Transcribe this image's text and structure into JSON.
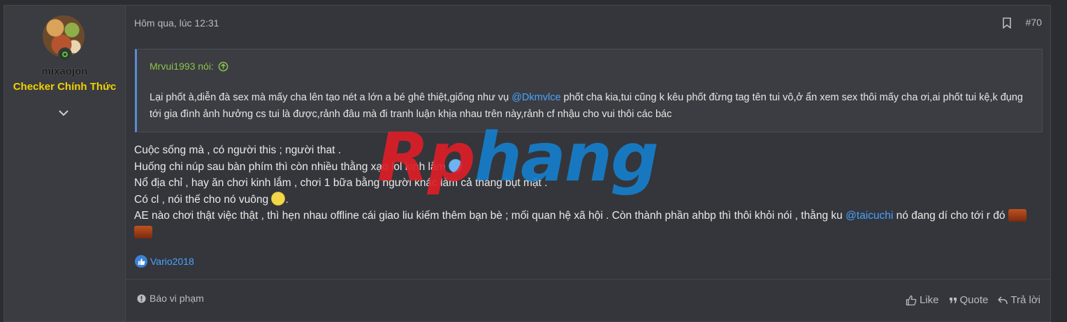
{
  "post": {
    "date": "Hôm qua, lúc 12:31",
    "number": "#70",
    "author": {
      "username": "mixaojon",
      "title": "Checker Chính Thức"
    },
    "quote": {
      "attribution": "Mrvui1993 nói:",
      "text_1": "Lại phốt à,diễn đà sex mà mấy cha lên tạo nét a lớn a bé ghê thiệt,giống như vụ ",
      "mention": "@Dkmvlce",
      "text_2": " phốt cha kia,tui cũng k kêu phốt đừng tag tên tui vô,ở ẩn xem sex thôi mấy cha ơi,ai phốt tui kệ,k đụng tới gia đình ảnh hưởng cs tui là được,rảnh đâu mà đi tranh luận khịa nhau trên này,rảnh cf nhậu cho vui thôi các bác"
    },
    "body": {
      "line1": "Cuộc sống mà , có người this ; người that .",
      "line2": "Huống chi núp sau bàn phím thì còn nhiều thằng xạo lol kinh lắm ",
      "line3": "Nổ địa chỉ , hay ăn chơi kinh lắm , chơi 1 bữa bằng người khác làm cả tháng bụt mặt .",
      "line4": "Có cl , nói thế cho nó vuông ",
      "line5a": "AE nào chơi thật việc thật , thì hẹn nhau offline cái giao liu kiếm thêm bạn bè ; mối quan hệ xã hội . Còn thành phần ahbp thì thôi khỏi nói , thằng ku ",
      "line5_mention": "@taicuchi",
      "line5b": " nó đang dí cho tới r đó "
    },
    "reactions": {
      "user": "Vario2018"
    },
    "footer": {
      "report": "Báo vi phạm",
      "like": "Like",
      "quote": "Quote",
      "reply": "Trả lời"
    },
    "watermark": {
      "part1": "Rp",
      "part2": "hang"
    }
  },
  "colors": {
    "title": "#f2d000",
    "link": "#4aa3ff",
    "quote_author": "#8cc34a",
    "quote_border": "#5b8bd6"
  },
  "icons": [
    "online-status-icon",
    "chevron-down-icon",
    "bookmark-icon",
    "arrow-up-circle-icon",
    "globe-emoji-icon",
    "smile-emoji-icon",
    "drum-emoji-icon",
    "like-reaction-icon",
    "report-icon",
    "thumbs-up-icon",
    "quote-icon",
    "reply-icon"
  ]
}
